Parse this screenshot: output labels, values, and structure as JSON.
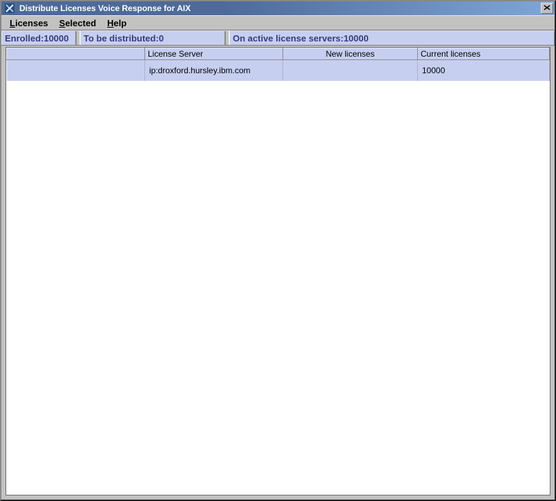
{
  "window": {
    "title": "Distribute Licenses Voice Response for AIX"
  },
  "menu": {
    "licenses": "Licenses",
    "selected": "Selected",
    "help": "Help"
  },
  "status": {
    "enrolled_label": "Enrolled: ",
    "enrolled_value": "10000",
    "tobe_label": "To be distributed: ",
    "tobe_value": "0",
    "active_label": "On active license servers:",
    "active_value": "10000"
  },
  "table": {
    "headers": {
      "lead": "",
      "server": "License Server",
      "newlic": "New licenses",
      "curlic": "Current licenses"
    },
    "rows": [
      {
        "lead": "",
        "server": "ip:droxford.hursley.ibm.com",
        "newlic": "",
        "curlic": "10000"
      }
    ]
  }
}
